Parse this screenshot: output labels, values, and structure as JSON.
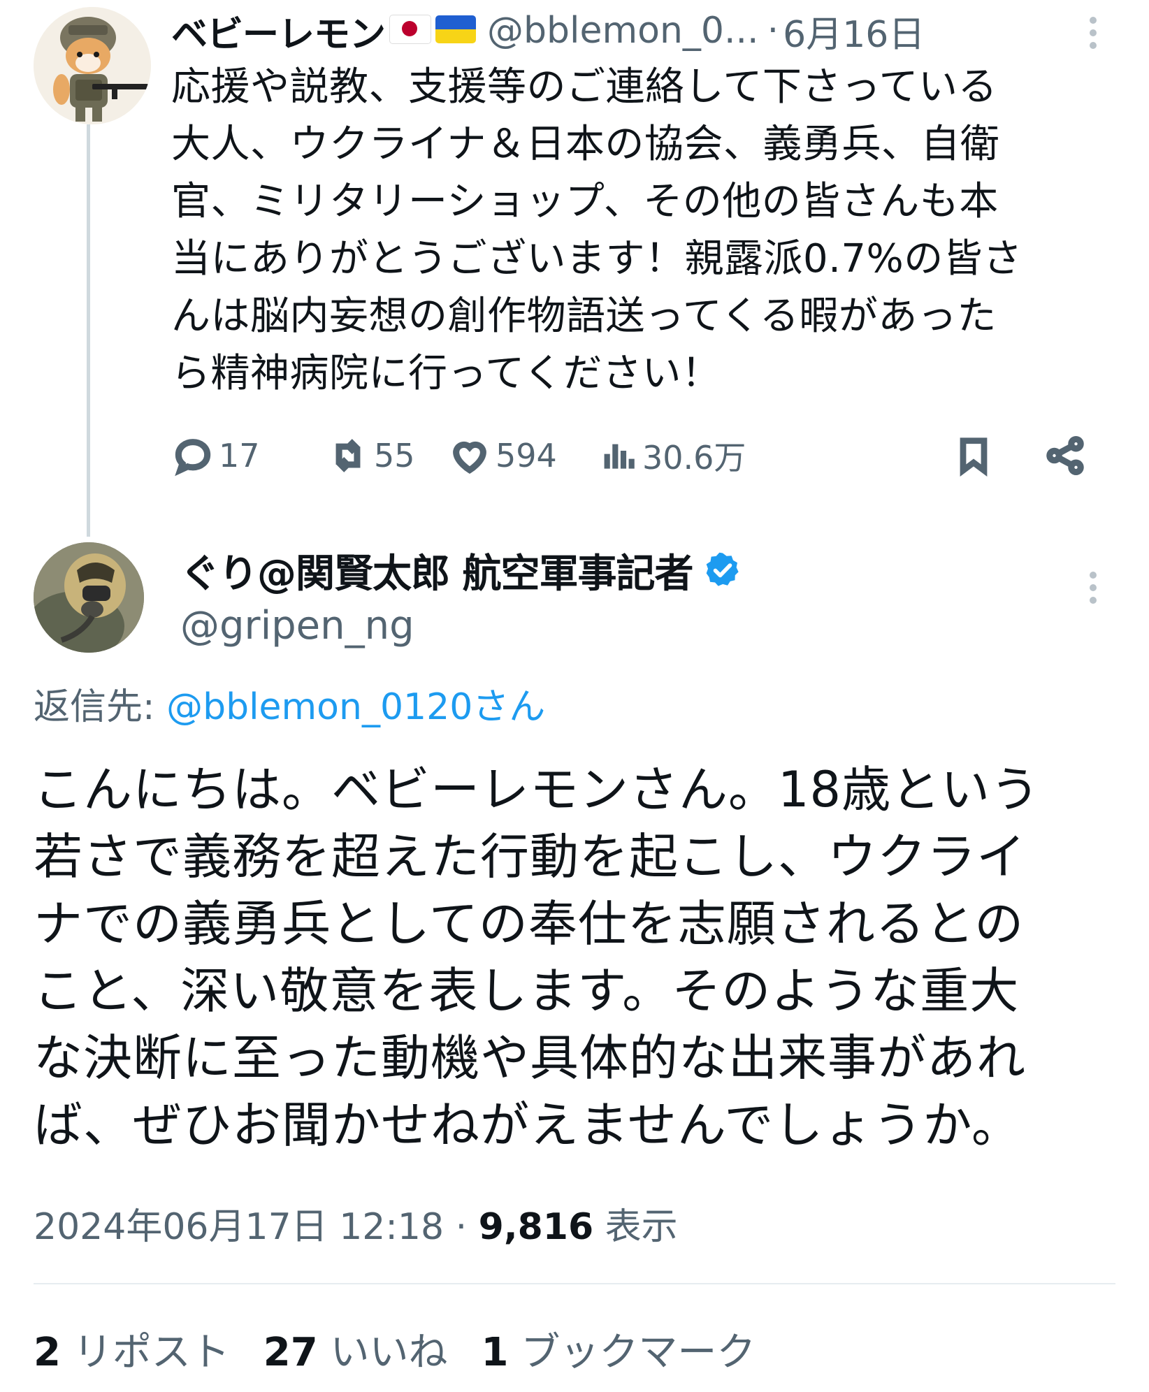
{
  "parent_tweet": {
    "display_name": "ベビーレモン",
    "flags": [
      "japan-flag",
      "ukraine-flag"
    ],
    "handle": "@bblemon_0...",
    "separator": "·",
    "date": "6月16日",
    "text": "応援や説教、支援等のご連絡して下さっている\n大人、ウクライナ＆日本の協会、義勇兵、自衛\n官、ミリタリーショップ、その他の皆さんも本\n当にありがとうございます！親露派0.7%の皆さ\nんは脳内妄想の創作物語送ってくる暇があった\nら精神病院に行ってください！",
    "actions": {
      "replies": "17",
      "reposts": "55",
      "likes": "594",
      "views": "30.6万"
    }
  },
  "reply_tweet": {
    "display_name": "ぐり@関賢太郎 航空軍事記者",
    "verified": true,
    "handle": "@gripen_ng",
    "reply_to_label": "返信先: ",
    "reply_to_mention": "@bblemon_0120さん",
    "text": "こんにちは。ベビーレモンさん。18歳という\n若さで義務を超えた行動を起こし、ウクライ\nナでの義勇兵としての奉仕を志願されるとの\nこと、深い敬意を表します。そのような重大\nな決断に至った動機や具体的な出来事があれ\nば、ぜひお聞かせねがえませんでしょうか。",
    "timestamp": "2024年06月17日 12:18",
    "separator": "·",
    "view_count": "9,816",
    "view_label": "表示",
    "stats": {
      "reposts_count": "2",
      "reposts_label": "リポスト",
      "likes_count": "27",
      "likes_label": "いいね",
      "bookmarks_count": "1",
      "bookmarks_label": "ブックマーク"
    }
  },
  "colors": {
    "text_primary": "#0f1419",
    "text_secondary": "#536471",
    "link": "#1d9bf0",
    "thread_line": "#cfd9de",
    "verified": "#1d9bf0"
  }
}
